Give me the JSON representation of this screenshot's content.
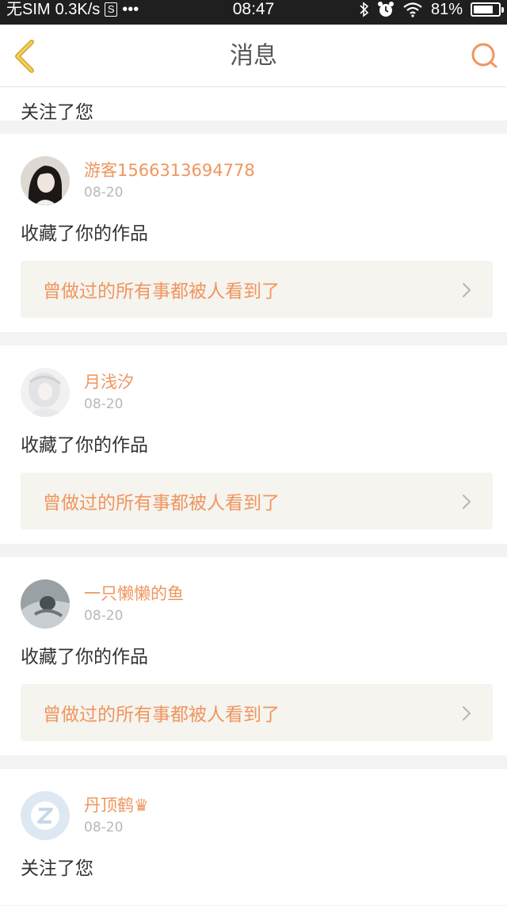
{
  "status_bar": {
    "carrier": "无SIM",
    "speed": "0.3K/s",
    "s_icon_label": "S",
    "dots": "•••",
    "time": "08:47",
    "battery_percent": "81%",
    "battery_level": 0.81
  },
  "nav": {
    "title": "消息",
    "back_icon": "chevron-left-icon",
    "search_icon": "search-icon",
    "accent_color": "#f0955e"
  },
  "messages": [
    {
      "action": "关注了您"
    },
    {
      "username": "游客1566313694778",
      "date": "08-20",
      "action": "收藏了你的作品",
      "work_title": "曾做过的所有事都被人看到了"
    },
    {
      "username": "月浅汐",
      "date": "08-20",
      "action": "收藏了你的作品",
      "work_title": "曾做过的所有事都被人看到了"
    },
    {
      "username": "一只懒懒的鱼",
      "date": "08-20",
      "action": "收藏了你的作品",
      "work_title": "曾做过的所有事都被人看到了"
    },
    {
      "username": "丹顶鹤",
      "badge": "♛",
      "date": "08-20",
      "action": "关注了您"
    }
  ]
}
